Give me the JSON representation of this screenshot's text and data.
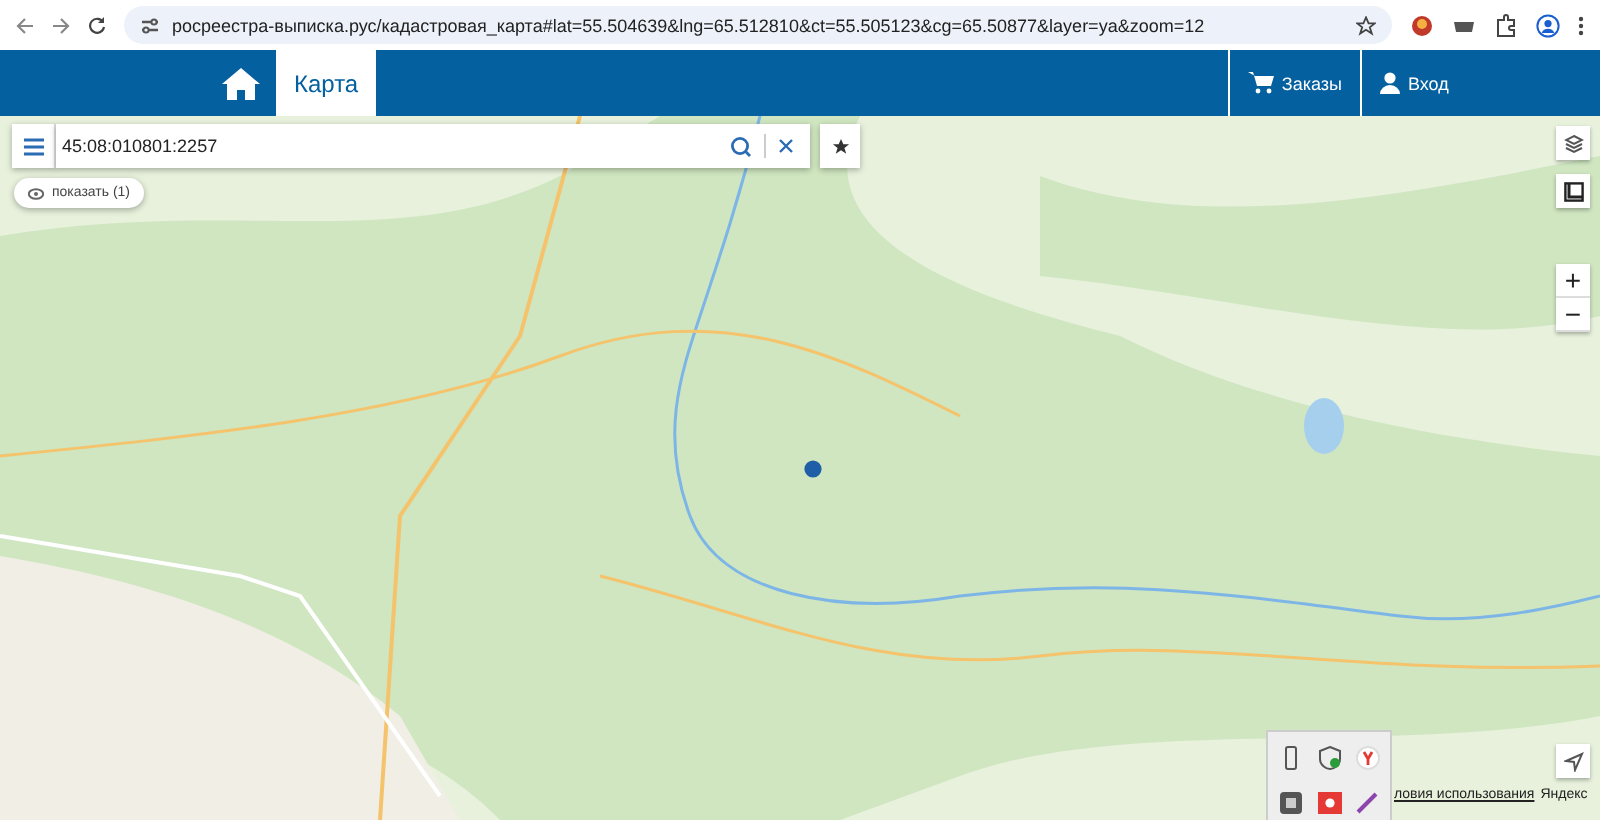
{
  "browser": {
    "url": "росреестра-выписка.рус/кадастровая_карта#lat=55.504639&lng=65.512810&ct=55.505123&cg=65.50877&layer=ya&zoom=12"
  },
  "header": {
    "tabs": [
      {
        "label": "Карта",
        "selected": true
      }
    ],
    "actions": [
      "Заказы",
      "Вход"
    ]
  },
  "search": {
    "value": "45:08:010801:2257"
  },
  "show_button": "показать (1)",
  "zoom_buttons": [
    "+",
    "−"
  ],
  "attribution": {
    "terms": "ловия использования",
    "brand": "Яндекс"
  }
}
